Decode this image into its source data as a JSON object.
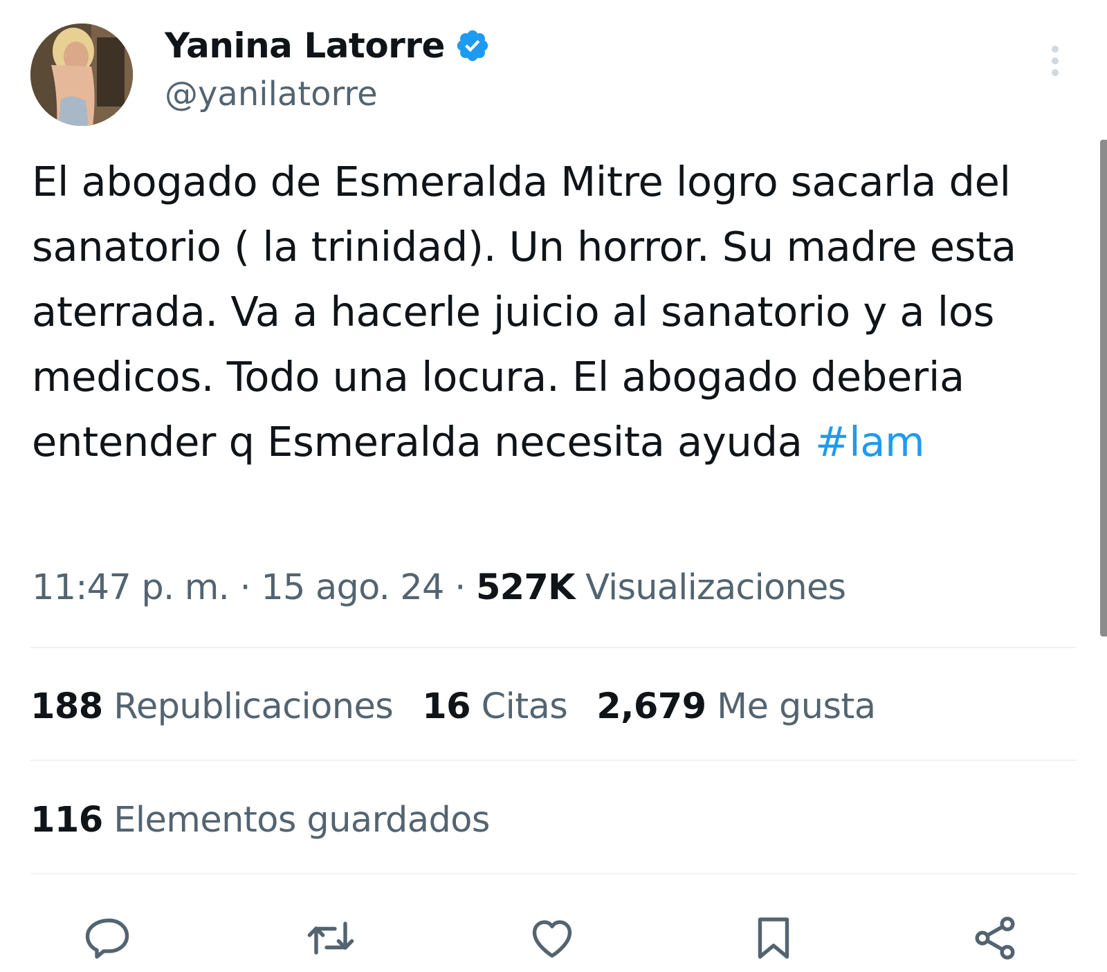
{
  "author": {
    "name": "Yanina Latorre",
    "handle": "@yanilatorre",
    "verified_icon": "verified-badge-icon"
  },
  "tweet": {
    "text": "El abogado de Esmeralda Mitre logro sacarla del sanatorio ( la trinidad). Un horror. Su madre esta aterrada. Va a hacerle juicio al sanatorio y a los medicos. Todo una locura. El abogado deberia entender q Esmeralda necesita ayuda ",
    "hashtag": "#lam"
  },
  "meta": {
    "time": "11:47 p. m.",
    "separator": "·",
    "date": "15 ago. 24",
    "views_count": "527K",
    "views_label": "Visualizaciones"
  },
  "stats": {
    "reposts_count": "188",
    "reposts_label": "Republicaciones",
    "quotes_count": "16",
    "quotes_label": "Citas",
    "likes_count": "2,679",
    "likes_label": "Me gusta",
    "bookmarks_count": "116",
    "bookmarks_label": "Elementos guardados"
  },
  "actions": [
    "reply-icon",
    "retweet-icon",
    "like-icon",
    "bookmark-icon",
    "share-icon"
  ],
  "colors": {
    "text": "#0f1419",
    "secondary": "#536471",
    "accent": "#1d9bf0",
    "divider": "#eff3f4"
  }
}
